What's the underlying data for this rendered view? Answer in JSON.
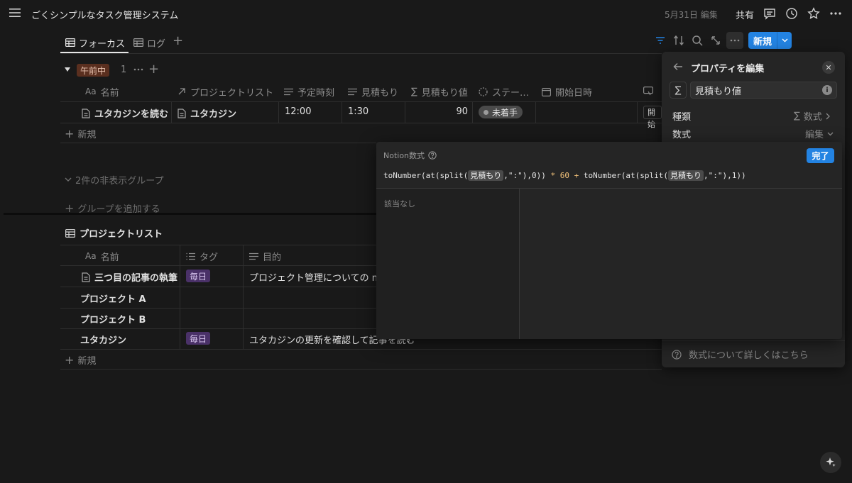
{
  "topbar": {
    "title": "ごくシンプルなタスク管理システム",
    "edited": "5月31日 編集",
    "share": "共有"
  },
  "views": {
    "tabs": [
      {
        "label": "フォーカス",
        "active": true
      },
      {
        "label": "ログ",
        "active": false
      }
    ],
    "new_button": "新規"
  },
  "group": {
    "tag": "午前中",
    "count": "1",
    "columns": [
      "名前",
      "プロジェクトリスト",
      "予定時刻",
      "見積もり",
      "見積もり値",
      "ステー…",
      "開始日時"
    ],
    "columns_prefix": "Aa",
    "rows": [
      {
        "name": "ユタカジンを読む",
        "project": "ユタカジン",
        "time": "12:00",
        "estimate": "1:30",
        "estimate_value": "90",
        "status": "未着手",
        "start": "開始"
      }
    ],
    "new_row": "新規",
    "hidden_groups": "2件の非表示グループ",
    "add_group": "グループを追加する"
  },
  "projects": {
    "title": "プロジェクトリスト",
    "columns": [
      "名前",
      "タグ",
      "目的"
    ],
    "columns_prefix": "Aa",
    "rows": [
      {
        "name": "三つ目の記事の執筆",
        "tag": "毎日",
        "purpose": "プロジェクト管理についての no"
      },
      {
        "name": "プロジェクト A",
        "tag": "",
        "purpose": ""
      },
      {
        "name": "プロジェクト B",
        "tag": "",
        "purpose": ""
      },
      {
        "name": "ユタカジン",
        "tag": "毎日",
        "purpose": "ユタカジンの更新を確認して記事を読む"
      }
    ],
    "new_row": "新規"
  },
  "panel": {
    "title": "プロパティを編集",
    "property_name": "見積もり値",
    "type_label": "種類",
    "type_value": "数式",
    "formula_label": "数式",
    "formula_value": "編集",
    "help": "数式について詳しくはこちら"
  },
  "formula": {
    "title": "Notion数式",
    "done": "完了",
    "code": {
      "p1": "toNumber(at(split(",
      "chip1": "見積もり",
      "p2": ",\":\"),0)) ",
      "op1": "* 60 +",
      "p3": " toNumber(at(split(",
      "chip2": "見積もり",
      "p4": ",\":\"),1))"
    },
    "empty": "該当なし"
  },
  "colors": {
    "accent": "#2383e2",
    "background": "#191919",
    "panel": "#252525",
    "tag_brown": "#5a2f1f",
    "tag_purple": "#4a3168"
  }
}
